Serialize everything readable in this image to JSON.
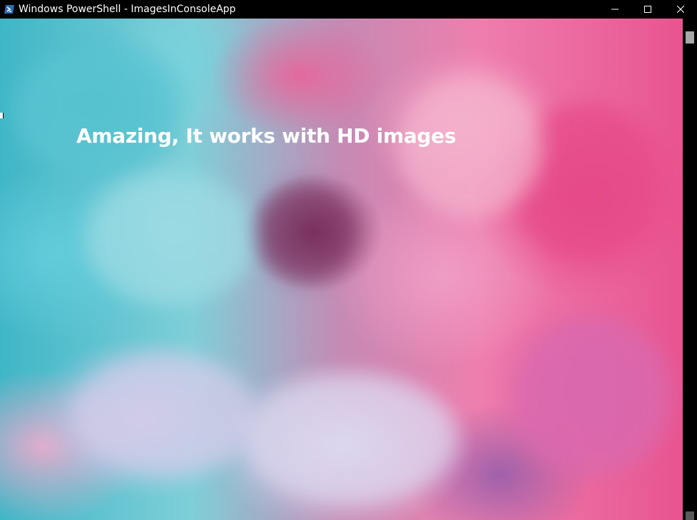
{
  "window": {
    "title": "Windows PowerShell - ImagesInConsoleApp",
    "icon": "powershell-icon",
    "controls": {
      "minimize": "minimize-icon",
      "maximize": "maximize-icon",
      "close": "close-icon"
    }
  },
  "console": {
    "caption": "Amazing, It works with HD images",
    "image": "pink-and-teal-smoke"
  },
  "colors": {
    "titlebar": "#000000",
    "caption_text": "#ffffff",
    "teal": "#3fb6c6",
    "pink": "#e8548f"
  }
}
